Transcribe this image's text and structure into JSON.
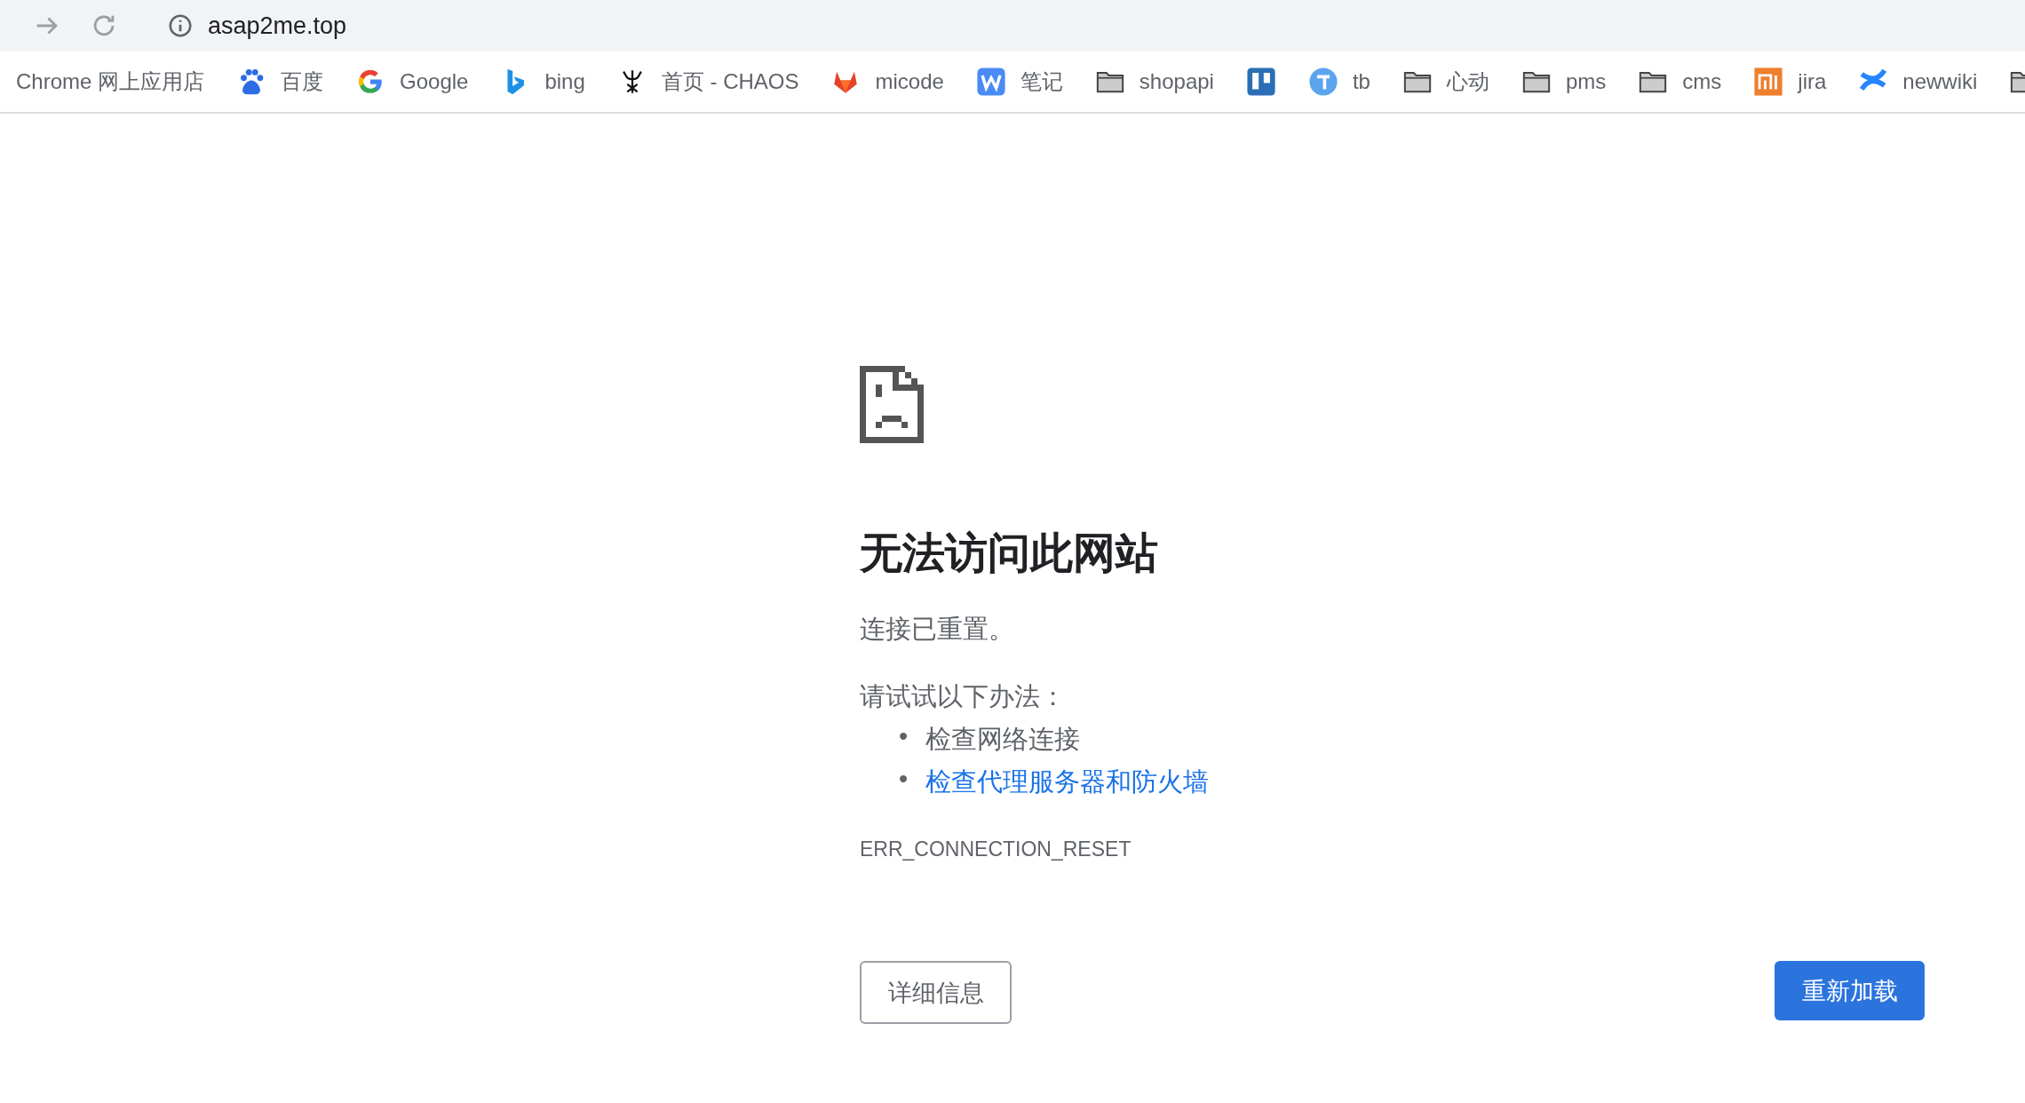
{
  "toolbar": {
    "url": "asap2me.top"
  },
  "bookmarks": [
    {
      "kind": "none",
      "label": "Chrome 网上应用店"
    },
    {
      "kind": "paw",
      "label": "百度"
    },
    {
      "kind": "google",
      "label": "Google"
    },
    {
      "kind": "bing",
      "label": "bing"
    },
    {
      "kind": "glyph",
      "label": "首页 - CHAOS"
    },
    {
      "kind": "fox",
      "label": "micode"
    },
    {
      "kind": "w",
      "label": "笔记"
    },
    {
      "kind": "folder",
      "label": "shopapi"
    },
    {
      "kind": "board"
    },
    {
      "kind": "t",
      "label": "tb"
    },
    {
      "kind": "folder",
      "label": "心动"
    },
    {
      "kind": "folder",
      "label": "pms"
    },
    {
      "kind": "folder",
      "label": "cms"
    },
    {
      "kind": "mi",
      "label": "jira"
    },
    {
      "kind": "cross",
      "label": "newwiki"
    },
    {
      "kind": "folder"
    }
  ],
  "error": {
    "title": "无法访问此网站",
    "message": "连接已重置。",
    "suggestions_heading": "请试试以下办法：",
    "suggestions": [
      {
        "bullet": "•",
        "text": "检查网络连接",
        "link": false
      },
      {
        "bullet": "•",
        "text": "检查代理服务器和防火墙",
        "link": true
      }
    ],
    "code": "ERR_CONNECTION_RESET"
  },
  "buttons": {
    "details": "详细信息",
    "reload": "重新加载"
  }
}
